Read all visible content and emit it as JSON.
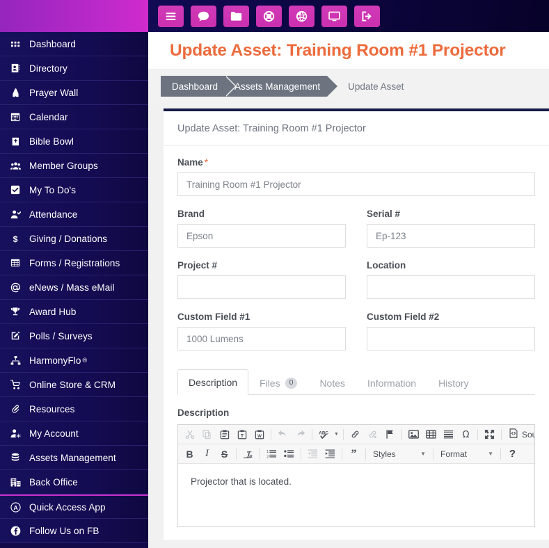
{
  "colors": {
    "sidebar_bg": "#130a4a",
    "brand_gradient_start": "#9526bd",
    "brand_gradient_end": "#d02bcd",
    "topbar_button": "#cf35b4",
    "page_title": "#ec6b3c",
    "breadcrumb": "#6d7480",
    "card_top_border": "#141a44",
    "accent_separator": "#c52fc9"
  },
  "topbar": {
    "buttons": [
      {
        "name": "menu-toggle",
        "icon": "hamburger-icon",
        "label": "Menu"
      },
      {
        "name": "messages",
        "icon": "chat-bubble-icon",
        "label": "Messages"
      },
      {
        "name": "files",
        "icon": "folder-icon",
        "label": "Files"
      },
      {
        "name": "support",
        "icon": "life-ring-icon",
        "label": "Support"
      },
      {
        "name": "website",
        "icon": "globe-icon",
        "label": "Website"
      },
      {
        "name": "screen",
        "icon": "desktop-monitor-icon",
        "label": "Screen"
      },
      {
        "name": "logout",
        "icon": "sign-out-icon",
        "label": "Logout"
      }
    ]
  },
  "sidebar": {
    "items": [
      {
        "label": "Dashboard",
        "icon": "grid-dots-icon"
      },
      {
        "label": "Directory",
        "icon": "address-book-icon"
      },
      {
        "label": "Prayer Wall",
        "icon": "praying-hands-icon"
      },
      {
        "label": "Calendar",
        "icon": "calendar-icon"
      },
      {
        "label": "Bible Bowl",
        "icon": "bible-book-icon"
      },
      {
        "label": "Member Groups",
        "icon": "users-group-icon"
      },
      {
        "label": "My To Do's",
        "icon": "checkbox-checked-icon"
      },
      {
        "label": "Attendance",
        "icon": "user-check-icon"
      },
      {
        "label": "Giving / Donations",
        "icon": "dollar-sign-icon"
      },
      {
        "label": "Forms / Registrations",
        "icon": "table-grid-icon"
      },
      {
        "label": "eNews / Mass eMail",
        "icon": "at-sign-icon"
      },
      {
        "label": "Award Hub",
        "icon": "trophy-icon"
      },
      {
        "label": "Polls / Surveys",
        "icon": "pen-square-icon"
      },
      {
        "label": "HarmonyFlo",
        "suffix": "®",
        "icon": "sitemap-icon"
      },
      {
        "label": "Online Store & CRM",
        "icon": "shopping-cart-icon"
      },
      {
        "label": "Resources",
        "icon": "paperclip-icon"
      },
      {
        "label": "My Account",
        "icon": "user-gear-icon"
      },
      {
        "label": "Assets Management",
        "icon": "database-stack-icon"
      },
      {
        "label": "Back Office",
        "icon": "office-building-icon"
      },
      {
        "label": "Quick Access App",
        "icon": "circle-a-icon",
        "separator_above": true
      },
      {
        "label": "Follow Us on FB",
        "icon": "facebook-icon"
      }
    ]
  },
  "header": {
    "page_title": "Update Asset: Training Room #1 Projector"
  },
  "breadcrumb": {
    "items": [
      "Dashboard",
      "Assets Management"
    ],
    "current": "Update Asset"
  },
  "card": {
    "heading": "Update Asset: Training Room #1 Projector"
  },
  "form": {
    "name": {
      "label": "Name",
      "required_mark": "*",
      "value": "Training Room #1 Projector"
    },
    "brand": {
      "label": "Brand",
      "value": "Epson"
    },
    "serial": {
      "label": "Serial #",
      "value": "Ep-123"
    },
    "project": {
      "label": "Project #",
      "value": ""
    },
    "location": {
      "label": "Location",
      "value": ""
    },
    "custom1": {
      "label": "Custom Field #1",
      "value": "1000 Lumens"
    },
    "custom2": {
      "label": "Custom Field #2",
      "value": ""
    }
  },
  "tabs": [
    {
      "label": "Description",
      "active": true
    },
    {
      "label": "Files",
      "badge": "0",
      "active": false
    },
    {
      "label": "Notes",
      "active": false
    },
    {
      "label": "Information",
      "active": false
    },
    {
      "label": "History",
      "active": false
    }
  ],
  "editor": {
    "section_label": "Description",
    "content": "Projector that is located.",
    "toolbar_row1": [
      {
        "icon": "cut-scissors-icon",
        "label": "Cut",
        "disabled": true
      },
      {
        "icon": "copy-icon",
        "label": "Copy",
        "disabled": true
      },
      {
        "icon": "paste-icon",
        "label": "Paste",
        "disabled": false
      },
      {
        "icon": "paste-as-text-icon",
        "label": "Paste as plain text",
        "disabled": false
      },
      {
        "icon": "paste-from-word-icon",
        "label": "Paste from Word",
        "disabled": false
      },
      {
        "icon": "separator",
        "label": ""
      },
      {
        "icon": "undo-arrow-icon",
        "label": "Undo",
        "disabled": true
      },
      {
        "icon": "redo-arrow-icon",
        "label": "Redo",
        "disabled": true
      },
      {
        "icon": "separator",
        "label": ""
      },
      {
        "icon": "spell-check-icon",
        "label": "Spell Check As You Type",
        "disabled": false
      },
      {
        "icon": "separator",
        "label": ""
      },
      {
        "icon": "link-icon",
        "label": "Link",
        "disabled": false
      },
      {
        "icon": "unlink-icon",
        "label": "Unlink",
        "disabled": true
      },
      {
        "icon": "anchor-flag-icon",
        "label": "Anchor",
        "disabled": false
      },
      {
        "icon": "separator",
        "label": ""
      },
      {
        "icon": "image-icon",
        "label": "Image",
        "disabled": false
      },
      {
        "icon": "table-icon",
        "label": "Table",
        "disabled": false
      },
      {
        "icon": "horizontal-rule-icon",
        "label": "Horizontal Line",
        "disabled": false
      },
      {
        "icon": "omega-special-char-icon",
        "label": "Insert Special Character",
        "disabled": false
      },
      {
        "icon": "separator",
        "label": ""
      },
      {
        "icon": "maximize-icon",
        "label": "Maximize",
        "disabled": false
      },
      {
        "icon": "separator",
        "label": ""
      },
      {
        "icon": "source-code-icon",
        "label": "Sour",
        "disabled": false
      }
    ],
    "toolbar_row2": [
      {
        "icon": "bold-icon",
        "label": "Bold",
        "disabled": false
      },
      {
        "icon": "italic-icon",
        "label": "Italic",
        "disabled": false
      },
      {
        "icon": "strikethrough-icon",
        "label": "Strike Through",
        "disabled": false
      },
      {
        "icon": "separator",
        "label": ""
      },
      {
        "icon": "remove-format-icon",
        "label": "Remove Format",
        "disabled": false
      },
      {
        "icon": "separator",
        "label": ""
      },
      {
        "icon": "numbered-list-icon",
        "label": "Insert/Remove Numbered List",
        "disabled": false
      },
      {
        "icon": "bulleted-list-icon",
        "label": "Insert/Remove Bulleted List",
        "disabled": false
      },
      {
        "icon": "separator",
        "label": ""
      },
      {
        "icon": "outdent-icon",
        "label": "Decrease Indent",
        "disabled": true
      },
      {
        "icon": "indent-icon",
        "label": "Increase Indent",
        "disabled": false
      },
      {
        "icon": "separator",
        "label": ""
      },
      {
        "icon": "blockquote-icon",
        "label": "Block Quote",
        "disabled": false
      }
    ],
    "styles_dropdown": {
      "label": "Styles"
    },
    "format_dropdown": {
      "label": "Format"
    },
    "help_button": {
      "label": "?"
    }
  }
}
